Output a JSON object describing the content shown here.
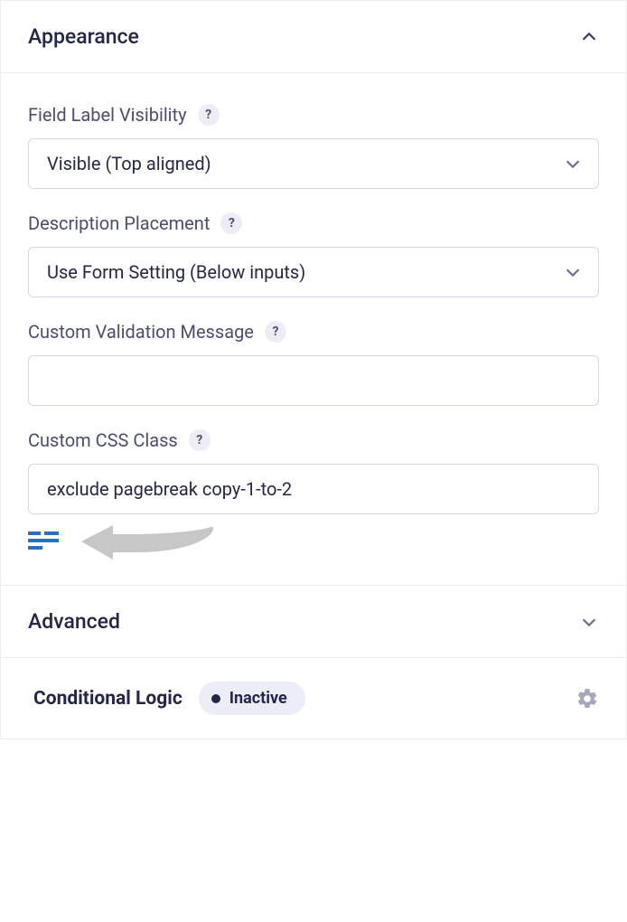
{
  "sections": {
    "appearance": {
      "title": "Appearance",
      "fields": {
        "label_visibility": {
          "label": "Field Label Visibility",
          "value": "Visible (Top aligned)"
        },
        "description_placement": {
          "label": "Description Placement",
          "value": "Use Form Setting (Below inputs)"
        },
        "custom_validation": {
          "label": "Custom Validation Message",
          "value": ""
        },
        "custom_css_class": {
          "label": "Custom CSS Class",
          "value": "exclude pagebreak copy-1-to-2"
        }
      }
    },
    "advanced": {
      "title": "Advanced"
    },
    "conditional_logic": {
      "title": "Conditional Logic",
      "status": "Inactive"
    }
  },
  "glyphs": {
    "help": "?"
  }
}
